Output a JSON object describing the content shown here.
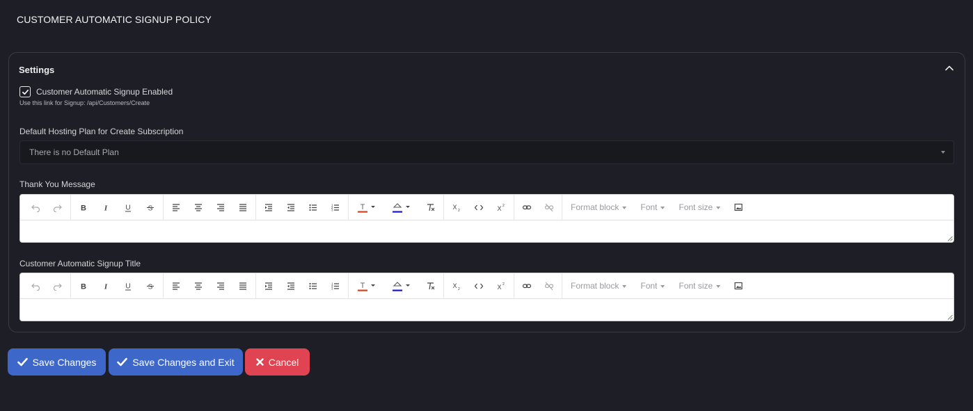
{
  "page": {
    "title": "CUSTOMER AUTOMATIC SIGNUP POLICY"
  },
  "settings": {
    "title": "Settings",
    "signup_enabled": {
      "label": "Customer Automatic Signup Enabled",
      "checked": true
    },
    "signup_hint": "Use this link for Signup: /api/Customers/Create",
    "hosting_plan": {
      "label": "Default Hosting Plan for Create Subscription",
      "value": "There is no Default Plan"
    },
    "thank_you": {
      "label": "Thank You Message",
      "value": ""
    },
    "signup_title": {
      "label": "Customer Automatic Signup Title",
      "value": ""
    }
  },
  "toolbar": {
    "format_block": "Format block",
    "font": "Font",
    "font_size": "Font size",
    "text_color": "#d9401c",
    "highlight_color": "#1a14d6"
  },
  "actions": {
    "save": "Save Changes",
    "save_exit": "Save Changes and Exit",
    "cancel": "Cancel"
  },
  "colors": {
    "background": "#1e1f26",
    "primary": "#3d67c9",
    "danger": "#e04351"
  }
}
